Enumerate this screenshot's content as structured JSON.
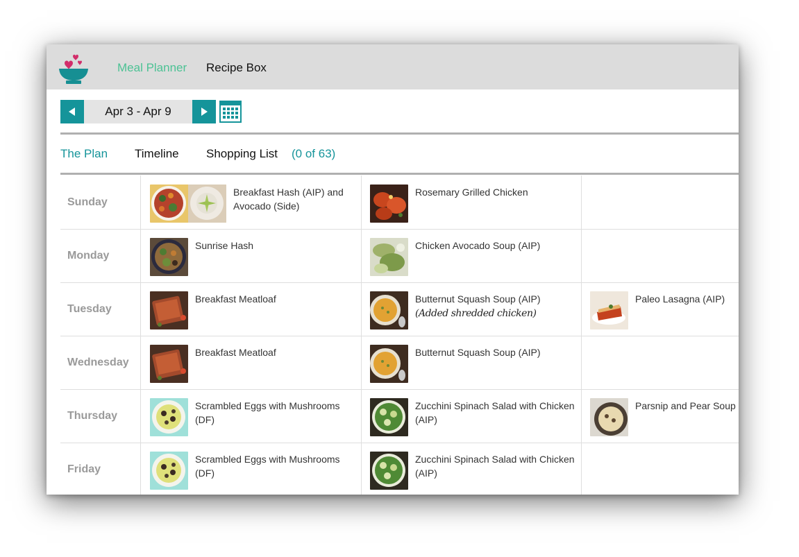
{
  "app": {
    "nav": {
      "meal_planner": "Meal Planner",
      "recipe_box": "Recipe Box"
    }
  },
  "week": {
    "range": "Apr 3 - Apr 9"
  },
  "tabs": {
    "plan": "The Plan",
    "timeline": "Timeline",
    "shopping": "Shopping List",
    "shopping_count": "(0 of 63)"
  },
  "colors": {
    "accent_teal": "#15949a",
    "nav_green": "#4cc294",
    "day_gray": "#9a9a9a"
  },
  "icons": {
    "logo": "bowl-with-hearts-icon",
    "prev": "triangle-left-icon",
    "next": "triangle-right-icon",
    "calendar": "calendar-icon"
  },
  "plan": [
    {
      "day": "Sunday",
      "meals": [
        {
          "title": "Breakfast Hash (AIP) and Avocado (Side)",
          "photo": "hash-and-avocado"
        },
        {
          "title": "Rosemary Grilled Chicken",
          "photo": "grilled-chicken"
        }
      ]
    },
    {
      "day": "Monday",
      "meals": [
        {
          "title": "Sunrise Hash",
          "photo": "hash-bowl"
        },
        {
          "title": "Chicken Avocado Soup (AIP)",
          "photo": "avocado-soup"
        }
      ]
    },
    {
      "day": "Tuesday",
      "meals": [
        {
          "title": "Breakfast Meatloaf",
          "photo": "meatloaf"
        },
        {
          "title": "Butternut Squash Soup (AIP)",
          "note": "(Added shredded chicken)",
          "photo": "squash-soup"
        },
        {
          "title": "Paleo Lasagna (AIP)",
          "photo": "lasagna"
        }
      ]
    },
    {
      "day": "Wednesday",
      "meals": [
        {
          "title": "Breakfast Meatloaf",
          "photo": "meatloaf"
        },
        {
          "title": "Butternut Squash Soup (AIP)",
          "photo": "squash-soup"
        }
      ]
    },
    {
      "day": "Thursday",
      "meals": [
        {
          "title": "Scrambled Eggs with Mushrooms (DF)",
          "photo": "eggs-mushrooms"
        },
        {
          "title": "Zucchini Spinach Salad with Chicken (AIP)",
          "photo": "zucchini-salad"
        },
        {
          "title": "Parsnip and Pear Soup",
          "photo": "parsnip-soup"
        }
      ]
    },
    {
      "day": "Friday",
      "meals": [
        {
          "title": "Scrambled Eggs with Mushrooms (DF)",
          "photo": "eggs-mushrooms"
        },
        {
          "title": "Zucchini Spinach Salad with Chicken (AIP)",
          "photo": "zucchini-salad"
        }
      ]
    }
  ]
}
